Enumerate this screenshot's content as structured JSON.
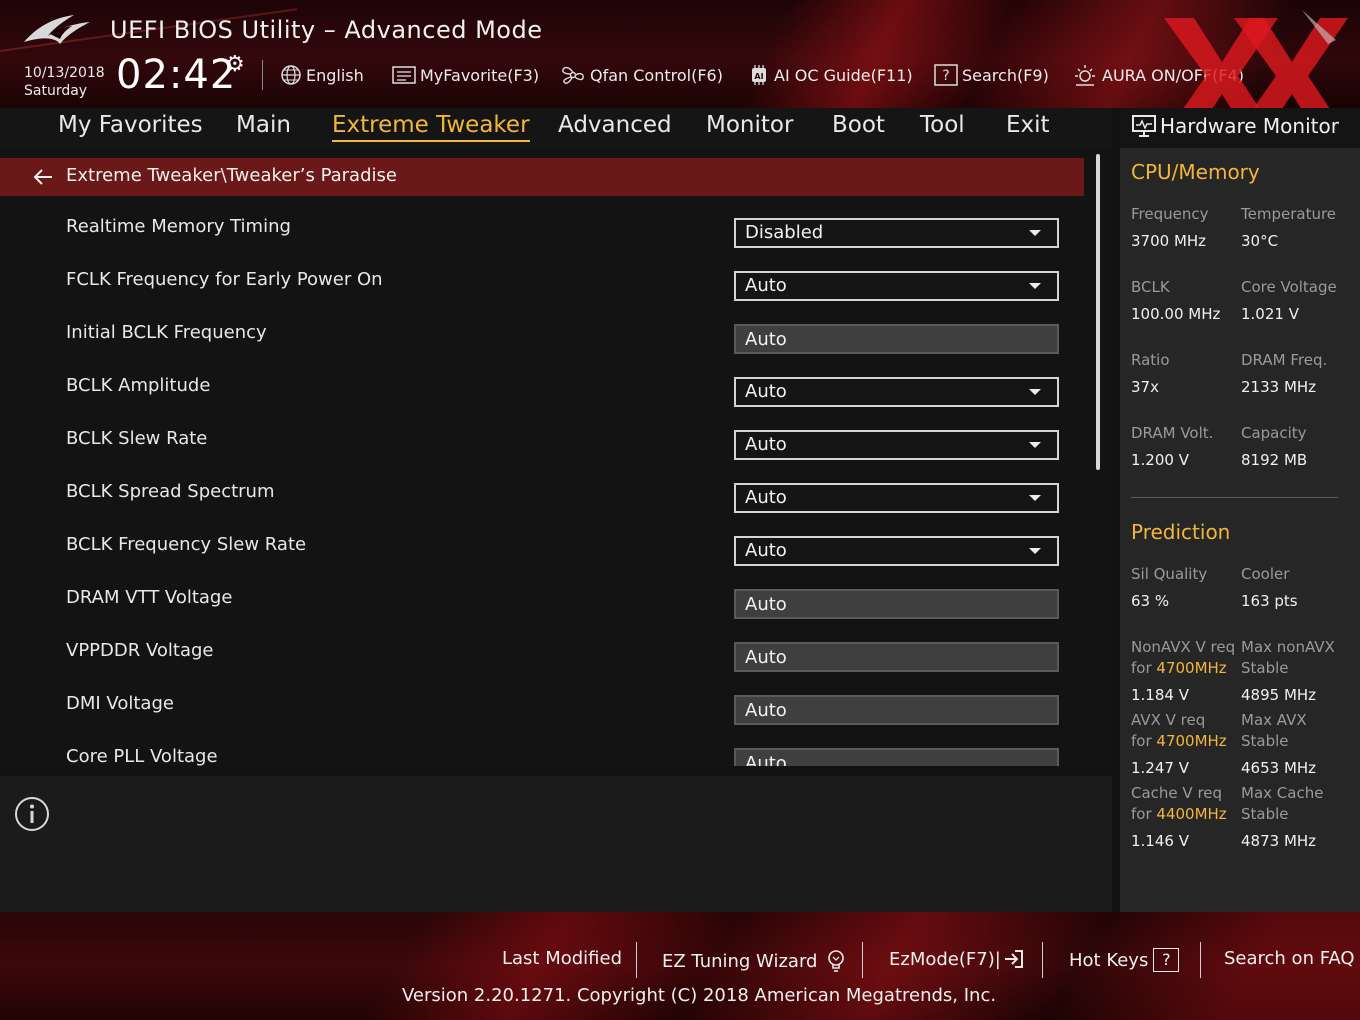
{
  "header": {
    "title": "UEFI BIOS Utility – Advanced Mode",
    "date": "10/13/2018",
    "weekday": "Saturday",
    "time": "02:42",
    "toolbar": {
      "language": "English",
      "favorite": "MyFavorite(F3)",
      "qfan": "Qfan Control(F6)",
      "ai_oc": "AI OC Guide(F11)",
      "search": "Search(F9)",
      "aura": "AURA ON/OFF(F4)"
    }
  },
  "nav": {
    "tabs": [
      "My Favorites",
      "Main",
      "Extreme Tweaker",
      "Advanced",
      "Monitor",
      "Boot",
      "Tool",
      "Exit"
    ],
    "active": "Extreme Tweaker"
  },
  "breadcrumb": "Extreme Tweaker\\Tweaker’s Paradise",
  "settings": [
    {
      "label": "Realtime Memory Timing",
      "value": "Disabled"
    },
    {
      "label": "FCLK Frequency for Early Power On",
      "value": "Auto"
    },
    {
      "label": "Initial BCLK Frequency",
      "value": "Auto"
    },
    {
      "label": "BCLK Amplitude",
      "value": "Auto"
    },
    {
      "label": "BCLK Slew Rate",
      "value": "Auto"
    },
    {
      "label": "BCLK Spread Spectrum",
      "value": "Auto"
    },
    {
      "label": "BCLK Frequency Slew Rate",
      "value": "Auto"
    },
    {
      "label": "DRAM VTT Voltage",
      "value": "Auto"
    },
    {
      "label": "VPPDDR Voltage",
      "value": "Auto"
    },
    {
      "label": "DMI Voltage",
      "value": "Auto"
    },
    {
      "label": "Core PLL Voltage",
      "value": "Auto"
    }
  ],
  "hw_monitor": {
    "title": "Hardware Monitor",
    "cpu_memory": {
      "heading": "CPU/Memory",
      "frequency_label": "Frequency",
      "frequency": "3700 MHz",
      "temperature_label": "Temperature",
      "temperature": "30°C",
      "bclk_label": "BCLK",
      "bclk": "100.00 MHz",
      "core_voltage_label": "Core Voltage",
      "core_voltage": "1.021 V",
      "ratio_label": "Ratio",
      "ratio": "37x",
      "dram_freq_label": "DRAM Freq.",
      "dram_freq": "2133 MHz",
      "dram_volt_label": "DRAM Volt.",
      "dram_volt": "1.200 V",
      "capacity_label": "Capacity",
      "capacity": "8192 MB"
    },
    "prediction": {
      "heading": "Prediction",
      "sil_quality_label": "Sil Quality",
      "sil_quality": "63 %",
      "cooler_label": "Cooler",
      "cooler": "163 pts",
      "nonavx_label": "NonAVX V req",
      "for_word": "for",
      "nonavx_freq": "4700MHz",
      "nonavx_v": "1.184 V",
      "max_nonavx_label": "Max nonAVX",
      "stable_word": "Stable",
      "max_nonavx": "4895 MHz",
      "avx_label": "AVX V req",
      "avx_freq": "4700MHz",
      "avx_v": "1.247 V",
      "max_avx_label": "Max AVX",
      "max_avx": "4653 MHz",
      "cache_label": "Cache V req",
      "cache_freq": "4400MHz",
      "cache_v": "1.146 V",
      "max_cache_label": "Max Cache",
      "max_cache": "4873 MHz"
    }
  },
  "footer": {
    "last_modified": "Last Modified",
    "ez_tuning": "EZ Tuning Wizard",
    "ezmode": "EzMode(F7)|",
    "hotkeys": "Hot Keys",
    "hotkeys_key": "?",
    "faq": "Search on FAQ",
    "version": "Version 2.20.1271. Copyright (C) 2018 American Megatrends, Inc."
  },
  "colors": {
    "accent": "#f2b63c",
    "breadcrumb_bg": "#6a1818",
    "panel_bg": "#262626",
    "main_bg": "#131313"
  }
}
